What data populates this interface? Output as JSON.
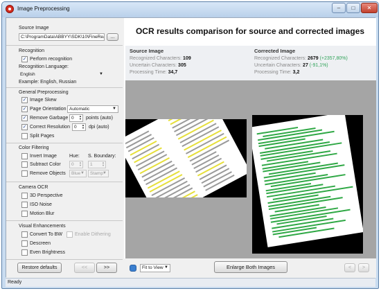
{
  "window": {
    "title": "Image Preprocessing",
    "min_glyph": "–",
    "max_glyph": "□",
    "close_glyph": "✕",
    "status": "Ready"
  },
  "left": {
    "source_image_label": "Source Image",
    "source_path": "C:\\ProgramData\\ABBYY\\SDK\\10\\FineRead",
    "browse_label": "...",
    "recognition_heading": "Recognition",
    "perform_recognition_label": "Perform recognition",
    "perform_recognition_checked": true,
    "language_label": "Recognition Language:",
    "language_value": "English",
    "example_label": "Example: English, Russian",
    "general_heading": "General Preprocessing",
    "image_skew_label": "Image Skew",
    "image_skew_checked": true,
    "page_orientation_label": "Page Orientation",
    "page_orientation_checked": true,
    "page_orientation_value": "Automatic",
    "remove_garbage_label": "Remove Garbage",
    "remove_garbage_checked": true,
    "remove_garbage_value": "0",
    "remove_garbage_unit": "points (auto)",
    "correct_resolution_label": "Correct Resolution",
    "correct_resolution_checked": true,
    "correct_resolution_value": "0",
    "correct_resolution_unit": "dpi (auto)",
    "split_pages_label": "Split Pages",
    "split_pages_checked": false,
    "color_heading": "Color Filtering",
    "invert_image_label": "Invert Image",
    "hue_label": "Hue:",
    "s_boundary_label": "S. Boundary:",
    "subtract_color_label": "Subtract Color",
    "hue_value": "0",
    "s_boundary_value": "1",
    "remove_objects_label": "Remove Objects",
    "remove_objects_color": "Blue",
    "remove_objects_type": "Stamp",
    "camera_heading": "Camera OCR",
    "perspective_label": "3D Perspective",
    "iso_noise_label": "ISO Noise",
    "motion_blur_label": "Motion Blur",
    "visual_heading": "Visual Enhancements",
    "convert_bw_label": "Convert To BW",
    "enable_dithering_label": "Enable Dithering",
    "descreen_label": "Descreen",
    "even_brightness_label": "Even Brightness",
    "restore_defaults_label": "Restore defaults",
    "prev_label": "<<",
    "next_label": ">>"
  },
  "right": {
    "heading": "OCR results comparison for source and corrected images",
    "source": {
      "title": "Source Image",
      "recognized_label": "Recognized Characters:",
      "recognized_value": "109",
      "uncertain_label": "Uncertain Characters:",
      "uncertain_value": "305",
      "time_label": "Processing Time:",
      "time_value": "34,7"
    },
    "corrected": {
      "title": "Corrected Image",
      "recognized_label": "Recognized Characters:",
      "recognized_value": "2679",
      "recognized_delta": "(+2357,80%)",
      "uncertain_label": "Uncertain Characters:",
      "uncertain_value": "27",
      "uncertain_delta": "(-91,1%)",
      "time_label": "Processing Time:",
      "time_value": "3,2"
    },
    "fit_value": "Fit to View",
    "enlarge_label": "Enlarge Both Images",
    "nav_prev": "<",
    "nav_next": ">"
  },
  "colors": {
    "accent_green": "#31a35a",
    "highlight_yellow": "#e6df3a",
    "recognized_text_green": "#2fa845"
  }
}
